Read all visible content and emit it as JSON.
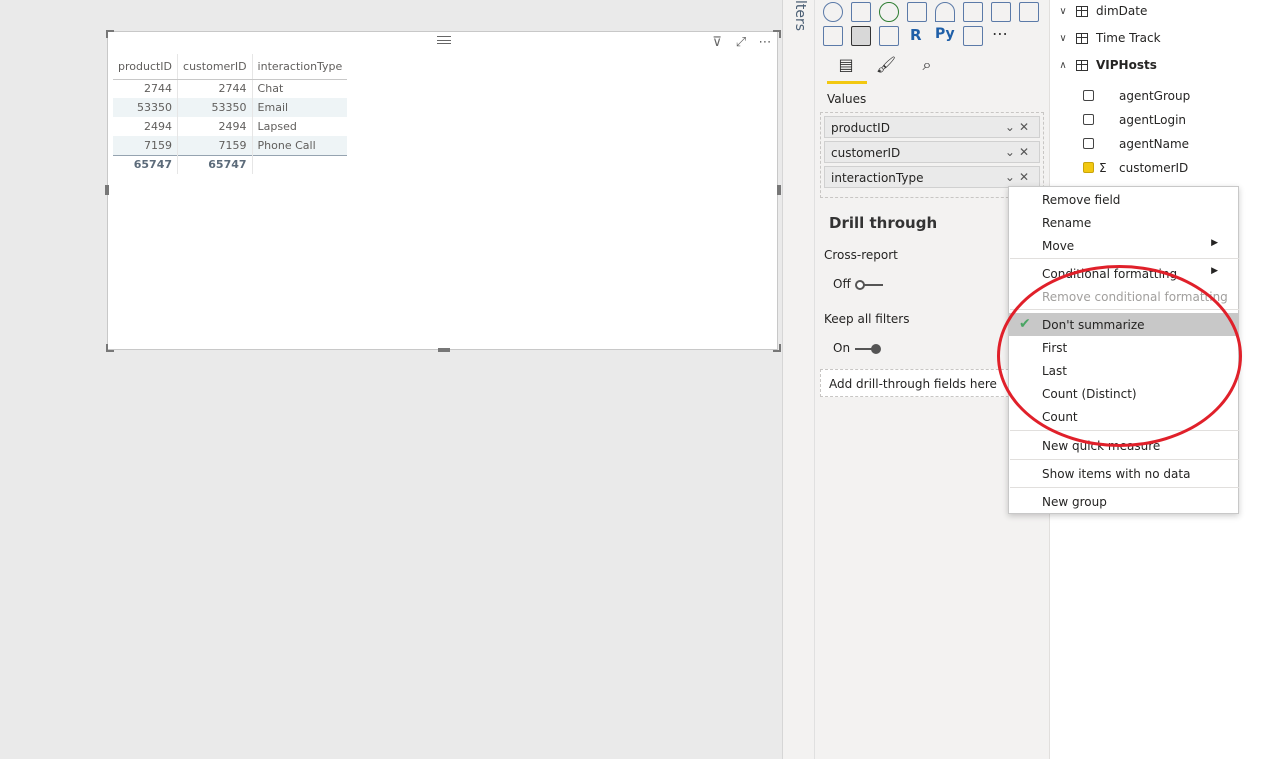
{
  "visual": {
    "columns": [
      "productID",
      "customerID",
      "interactionType"
    ],
    "rows": [
      [
        "2744",
        "2744",
        "Chat"
      ],
      [
        "53350",
        "53350",
        "Email"
      ],
      [
        "2494",
        "2494",
        "Lapsed"
      ],
      [
        "7159",
        "7159",
        "Phone Call"
      ]
    ],
    "totals": [
      "65747",
      "65747",
      ""
    ]
  },
  "filters_pane": {
    "label": "lters"
  },
  "viz_pane": {
    "values_label": "Values",
    "wells": [
      "productID",
      "customerID",
      "interactionType"
    ],
    "drill_through": {
      "title": "Drill through",
      "cross_report_label": "Cross-report",
      "cross_report_state": "Off",
      "keep_filters_label": "Keep all filters",
      "keep_filters_state": "On",
      "add_fields": "Add drill-through fields here"
    }
  },
  "fields_pane": {
    "tables": [
      "dimDate",
      "Time Track",
      "VIPHosts"
    ],
    "fields": [
      {
        "name": "agentGroup",
        "checked": false
      },
      {
        "name": "agentLogin",
        "checked": false
      },
      {
        "name": "agentName",
        "checked": false
      },
      {
        "name": "customerID",
        "checked": true
      }
    ]
  },
  "context_menu": {
    "items": [
      "Remove field",
      "Rename",
      "Move",
      "Conditional formatting",
      "Remove conditional formatting",
      "Don't summarize",
      "First",
      "Last",
      "Count (Distinct)",
      "Count",
      "New quick measure",
      "Show items with no data",
      "New group"
    ]
  },
  "colors": {
    "accent": "#f2c811",
    "annotation": "#e0202a",
    "check": "#4aa564"
  }
}
